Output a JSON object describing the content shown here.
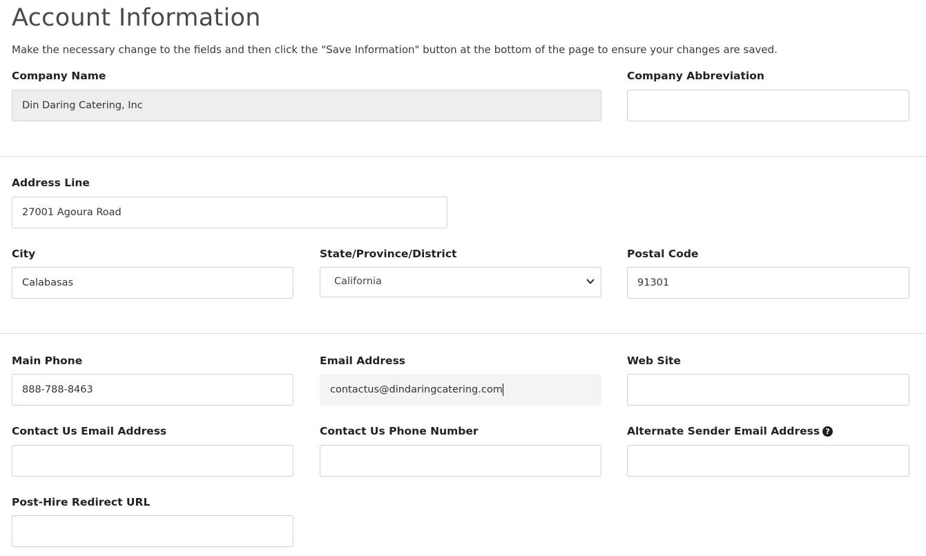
{
  "page": {
    "title": "Account Information",
    "intro": "Make the necessary change to the fields and then click the \"Save Information\" button at the bottom of the page to ensure your changes are saved."
  },
  "company": {
    "name_label": "Company Name",
    "name_value": "Din Daring Catering, Inc",
    "abbreviation_label": "Company Abbreviation",
    "abbreviation_value": ""
  },
  "address": {
    "line_label": "Address Line",
    "line_value": "27001 Agoura Road",
    "city_label": "City",
    "city_value": "Calabasas",
    "state_label": "State/Province/District",
    "state_value": "California",
    "postal_label": "Postal Code",
    "postal_value": "91301"
  },
  "contact": {
    "main_phone_label": "Main Phone",
    "main_phone_value": "888-788-8463",
    "email_label": "Email Address",
    "email_value": "contactus@dindaringcatering.com",
    "website_label": "Web Site",
    "website_value": "",
    "contact_email_label": "Contact Us Email Address",
    "contact_email_value": "",
    "contact_phone_label": "Contact Us Phone Number",
    "contact_phone_value": "",
    "alt_sender_label": "Alternate Sender Email Address",
    "alt_sender_value": "",
    "alt_sender_help_icon": "question-circle-icon",
    "redirect_label": "Post-Hire Redirect URL",
    "redirect_value": ""
  }
}
